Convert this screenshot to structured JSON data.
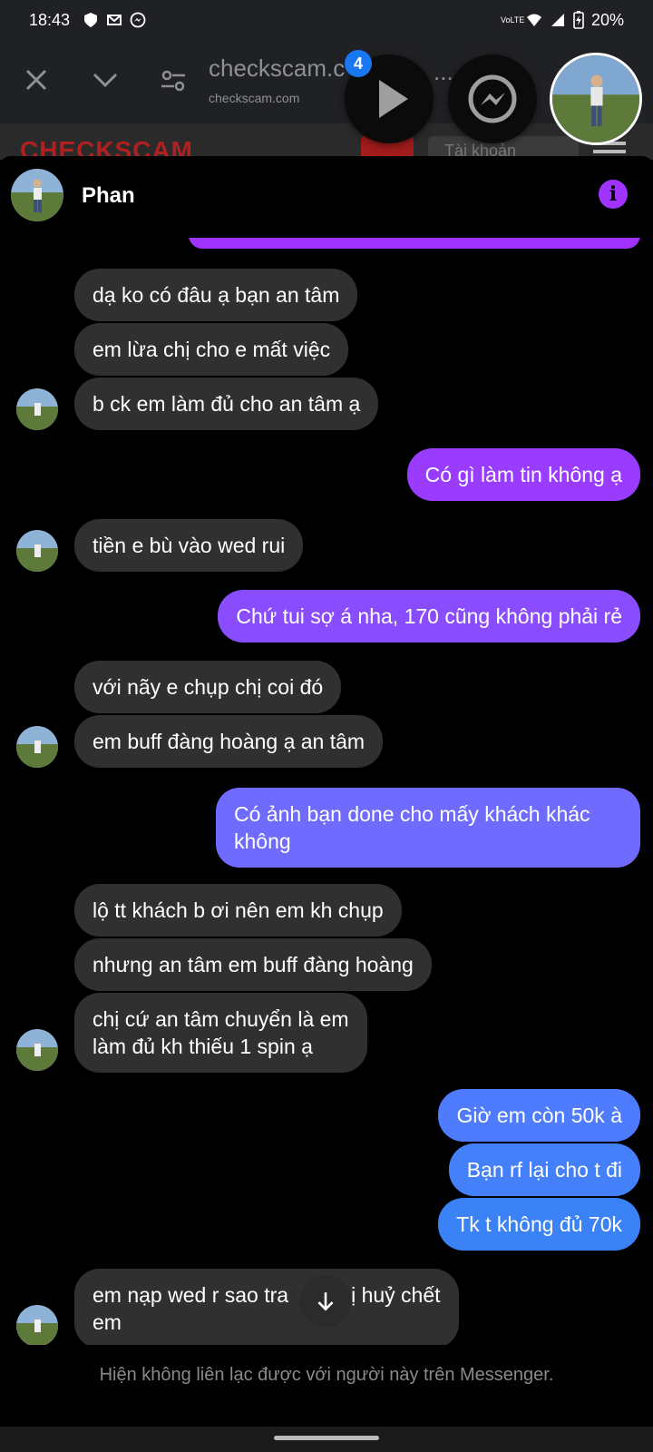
{
  "status_bar": {
    "time": "18:43",
    "battery": "20%",
    "network_label": "VoLTE"
  },
  "browser": {
    "title": "checkscam.c",
    "url": "checkscam.com",
    "more": "..."
  },
  "site": {
    "logo": "CHECKSCAM",
    "search_placeholder": "Tài khoản"
  },
  "chat_heads": {
    "badge_count": "4"
  },
  "chat": {
    "contact_name": "Phan",
    "messages": [
      {
        "dir": "in",
        "text": "dạ ko có đâu ạ bạn an tâm"
      },
      {
        "dir": "in",
        "text": "em lừa chị cho e mất việc"
      },
      {
        "dir": "in",
        "text": "b ck em làm đủ cho an tâm ạ"
      },
      {
        "dir": "out",
        "text": "Có gì làm tin không ạ"
      },
      {
        "dir": "in",
        "text": "tiền e bù vào wed rui"
      },
      {
        "dir": "out",
        "text": "Chứ tui sợ á nha, 170 cũng không phải rẻ"
      },
      {
        "dir": "in",
        "text": "với nãy e chụp chị coi đó"
      },
      {
        "dir": "in",
        "text": "em buff đàng hoàng ạ an tâm"
      },
      {
        "dir": "out",
        "line1": "Có ảnh bạn done cho mấy khách khác",
        "line2": "không"
      },
      {
        "dir": "in",
        "text": "lộ tt khách b ơi nên em kh chụp"
      },
      {
        "dir": "in",
        "text": "nhưng an tâm em buff đàng hoàng"
      },
      {
        "dir": "in",
        "line1": "chị cứ an tâm chuyển là em",
        "line2": "làm đủ kh thiếu 1 spin ạ"
      },
      {
        "dir": "out",
        "text": "Giờ em còn 50k à"
      },
      {
        "dir": "out",
        "text": "Bạn rf lại cho t đi"
      },
      {
        "dir": "out",
        "text": "Tk t không đủ 70k"
      },
      {
        "dir": "in",
        "line1": "em nạp wed r sao tra    n chị huỷ chết",
        "line2": "em"
      }
    ],
    "footer_note": "Hiện không liên lạc được với người này trên Messenger."
  },
  "colors": {
    "incoming_bubble": "#303030",
    "outgoing_top": "#a033ff",
    "outgoing_mid": "#6f6bff",
    "outgoing_bottom": "#3b82f6",
    "info_icon": "#a033ff"
  }
}
